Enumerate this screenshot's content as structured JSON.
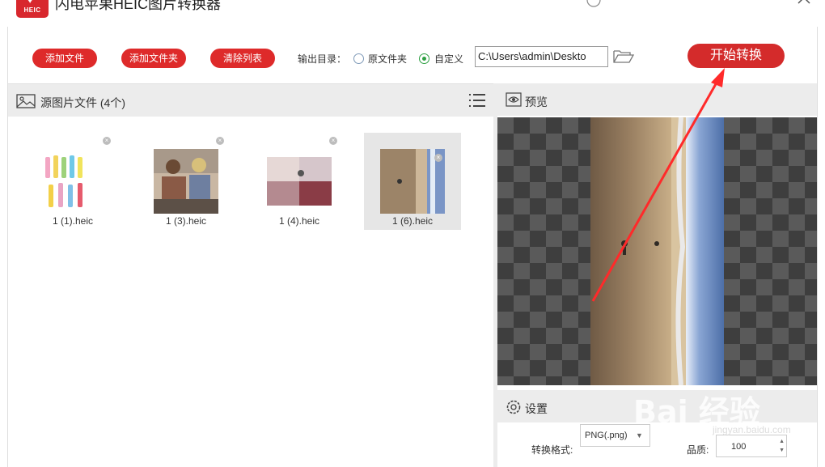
{
  "app": {
    "title": "闪电苹果HEIC图片转换器",
    "logo_text": "HEIC"
  },
  "toolbar": {
    "add_file": "添加文件",
    "add_folder": "添加文件夹",
    "clear_list": "清除列表",
    "output_dir_label": "输出目录：",
    "radio_original": "原文件夹",
    "radio_custom": "自定义",
    "selected_output": "自定义",
    "output_path": "C:\\Users\\admin\\Deskto",
    "start": "开始转换"
  },
  "left_panel": {
    "title": "源图片文件 (4个)",
    "files": [
      {
        "name": "1 (1).heic"
      },
      {
        "name": "1 (3).heic"
      },
      {
        "name": "1 (4).heic"
      },
      {
        "name": "1 (6).heic",
        "selected": true
      }
    ]
  },
  "preview": {
    "title": "预览"
  },
  "settings": {
    "title": "设置",
    "format_label": "转换格式:",
    "format_value": "PNG(.png)",
    "quality_label": "品质:",
    "quality_value": "100"
  },
  "colors": {
    "accent_red": "#de2a2a",
    "radio_green": "#2ea043",
    "arrow_red": "#ff2a2a"
  },
  "watermark": {
    "text": "Bai 经验",
    "sub": "jingyan.baidu.com"
  }
}
